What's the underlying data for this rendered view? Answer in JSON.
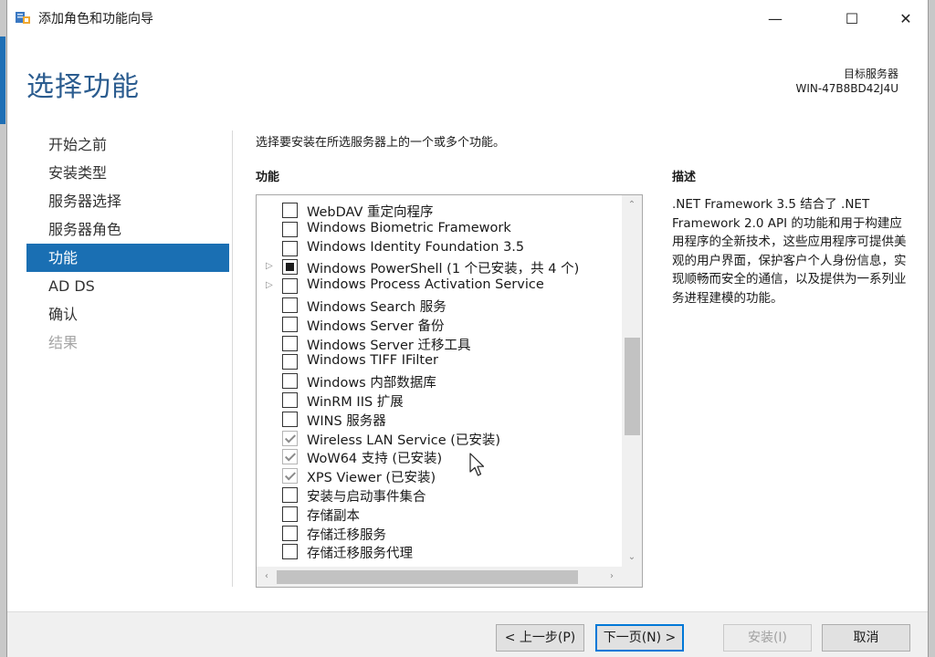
{
  "window": {
    "title": "添加角色和功能向导",
    "controls": {
      "minimize": "—",
      "maximize": "☐",
      "close": "✕"
    }
  },
  "header": {
    "page_title": "选择功能",
    "target_label": "目标服务器",
    "target_name": "WIN-47B8BD42J4U"
  },
  "sidebar": {
    "items": [
      {
        "label": "开始之前",
        "state": "normal"
      },
      {
        "label": "安装类型",
        "state": "normal"
      },
      {
        "label": "服务器选择",
        "state": "normal"
      },
      {
        "label": "服务器角色",
        "state": "normal"
      },
      {
        "label": "功能",
        "state": "active"
      },
      {
        "label": "AD DS",
        "state": "normal"
      },
      {
        "label": "确认",
        "state": "normal"
      },
      {
        "label": "结果",
        "state": "disabled"
      }
    ]
  },
  "main": {
    "intro": "选择要安装在所选服务器上的一个或多个功能。",
    "features_header": "功能",
    "features": [
      {
        "label": "WebDAV 重定向程序",
        "check": "unchecked",
        "expandable": false
      },
      {
        "label": "Windows Biometric Framework",
        "check": "unchecked",
        "expandable": false
      },
      {
        "label": "Windows Identity Foundation 3.5",
        "check": "unchecked",
        "expandable": false
      },
      {
        "label": "Windows PowerShell (1 个已安装，共 4 个)",
        "check": "partial",
        "expandable": true
      },
      {
        "label": "Windows Process Activation Service",
        "check": "unchecked",
        "expandable": true
      },
      {
        "label": "Windows Search 服务",
        "check": "unchecked",
        "expandable": false
      },
      {
        "label": "Windows Server 备份",
        "check": "unchecked",
        "expandable": false
      },
      {
        "label": "Windows Server 迁移工具",
        "check": "unchecked",
        "expandable": false
      },
      {
        "label": "Windows TIFF IFilter",
        "check": "unchecked",
        "expandable": false
      },
      {
        "label": "Windows 内部数据库",
        "check": "unchecked",
        "expandable": false
      },
      {
        "label": "WinRM IIS 扩展",
        "check": "unchecked",
        "expandable": false
      },
      {
        "label": "WINS 服务器",
        "check": "unchecked",
        "expandable": false
      },
      {
        "label": "Wireless LAN Service (已安装)",
        "check": "checked",
        "expandable": false
      },
      {
        "label": "WoW64 支持 (已安装)",
        "check": "checked",
        "expandable": false
      },
      {
        "label": "XPS Viewer (已安装)",
        "check": "checked",
        "expandable": false
      },
      {
        "label": "安装与启动事件集合",
        "check": "unchecked",
        "expandable": false
      },
      {
        "label": "存储副本",
        "check": "unchecked",
        "expandable": false
      },
      {
        "label": "存储迁移服务",
        "check": "unchecked",
        "expandable": false
      },
      {
        "label": "存储迁移服务代理",
        "check": "unchecked",
        "expandable": false
      }
    ],
    "description_header": "描述",
    "description": ".NET Framework 3.5 结合了 .NET Framework 2.0 API 的功能和用于构建应用程序的全新技术，这些应用程序可提供美观的用户界面，保护客户个人身份信息，实现顺畅而安全的通信，以及提供为一系列业务进程建模的功能。"
  },
  "footer": {
    "prev": "< 上一步(P)",
    "next": "下一页(N) >",
    "install": "安装(I)",
    "cancel": "取消"
  },
  "colors": {
    "accent": "#1a6fb3",
    "title_blue": "#2b5c8f",
    "focus_border": "#0078d7"
  }
}
